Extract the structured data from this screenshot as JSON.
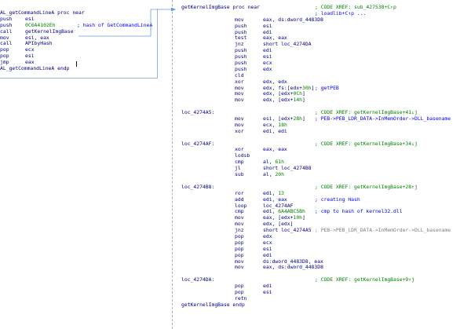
{
  "left_block": [
    {
      "label": "AL_getCommandLineA proc near",
      "mn": "",
      "op": "",
      "cmt": ""
    },
    {
      "label": "",
      "mn": "push",
      "op": "esi",
      "cmt": ""
    },
    {
      "label": "",
      "mn": "push",
      "op": "0C6A4102Eh",
      "cmt": "; hash of GetCommandLineA"
    },
    {
      "label": "",
      "mn": "call",
      "op": "getKernelImgBase",
      "cmt": ""
    },
    {
      "label": "",
      "mn": "mov",
      "op": "esi, eax",
      "cmt": ""
    },
    {
      "label": "",
      "mn": "call",
      "op": "APIbyHash",
      "cmt": ""
    },
    {
      "label": "",
      "mn": "pop",
      "op": "ecx",
      "cmt": ""
    },
    {
      "label": "",
      "mn": "pop",
      "op": "esi",
      "cmt": ""
    },
    {
      "label": "",
      "mn": "jmp",
      "op": "eax",
      "cmt": ""
    },
    {
      "label": "AL_getCommandLineA endp",
      "mn": "",
      "op": "",
      "cmt": ""
    }
  ],
  "right_block": [
    {
      "label": "getKernelImgBase proc near",
      "mn": "",
      "op": "",
      "cmt": "; CODE XREF: sub_427538+C↑p"
    },
    {
      "label": "",
      "mn": "",
      "op": "",
      "cmt": "; loadlib+C↑p ..."
    },
    {
      "label": "",
      "mn": "mov",
      "op": "eax, ds:dword_4483D8",
      "cmt": ""
    },
    {
      "label": "",
      "mn": "push",
      "op": "esi",
      "cmt": ""
    },
    {
      "label": "",
      "mn": "push",
      "op": "edi",
      "cmt": ""
    },
    {
      "label": "",
      "mn": "test",
      "op": "eax, eax",
      "cmt": ""
    },
    {
      "label": "",
      "mn": "jnz",
      "op": "short loc_4274DA",
      "cmt": ""
    },
    {
      "label": "",
      "mn": "push",
      "op": "edi",
      "cmt": ""
    },
    {
      "label": "",
      "mn": "push",
      "op": "esi",
      "cmt": ""
    },
    {
      "label": "",
      "mn": "push",
      "op": "ecx",
      "cmt": ""
    },
    {
      "label": "",
      "mn": "push",
      "op": "edx",
      "cmt": ""
    },
    {
      "label": "",
      "mn": "cld",
      "op": "",
      "cmt": ""
    },
    {
      "label": "",
      "mn": "xor",
      "op": "edx, edx",
      "cmt": ""
    },
    {
      "label": "",
      "mn": "mov",
      "op": "edx, fs:[edx+30h]",
      "cmt": "; getPEB"
    },
    {
      "label": "",
      "mn": "mov",
      "op": "edx, [edx+0Ch]",
      "cmt": ""
    },
    {
      "label": "",
      "mn": "mov",
      "op": "edx, [edx+14h]",
      "cmt": ""
    },
    {
      "label": "",
      "mn": "",
      "op": "",
      "cmt": ""
    },
    {
      "label": "loc_4274A5:",
      "mn": "",
      "op": "",
      "cmt": "; CODE XREF: getKernelImgBase+41↓j"
    },
    {
      "label": "",
      "mn": "mov",
      "op": "esi, [edx+28h]",
      "cmt": "; PEB->PEB_LDR_DATA->InMemOrder->DLL_basename"
    },
    {
      "label": "",
      "mn": "mov",
      "op": "ecx, 18h",
      "cmt": ""
    },
    {
      "label": "",
      "mn": "xor",
      "op": "edi, edi",
      "cmt": ""
    },
    {
      "label": "",
      "mn": "",
      "op": "",
      "cmt": ""
    },
    {
      "label": "loc_4274AF:",
      "mn": "",
      "op": "",
      "cmt": "; CODE XREF: getKernelImgBase+34↓j"
    },
    {
      "label": "",
      "mn": "xor",
      "op": "eax, eax",
      "cmt": ""
    },
    {
      "label": "",
      "mn": "lodsb",
      "op": "",
      "cmt": ""
    },
    {
      "label": "",
      "mn": "cmp",
      "op": "al, 61h",
      "cmt": ""
    },
    {
      "label": "",
      "mn": "jl",
      "op": "short loc_4274B8",
      "cmt": ""
    },
    {
      "label": "",
      "mn": "sub",
      "op": "al, 20h",
      "cmt": ""
    },
    {
      "label": "",
      "mn": "",
      "op": "",
      "cmt": ""
    },
    {
      "label": "loc_4274B8:",
      "mn": "",
      "op": "",
      "cmt": "; CODE XREF: getKernelImgBase+28↑j"
    },
    {
      "label": "",
      "mn": "ror",
      "op": "edi, 13",
      "cmt": ""
    },
    {
      "label": "",
      "mn": "add",
      "op": "edi, eax",
      "cmt": "; creating Hash"
    },
    {
      "label": "",
      "mn": "loop",
      "op": "loc_4274AF",
      "cmt": ""
    },
    {
      "label": "",
      "mn": "cmp",
      "op": "edi, 6A4ABC5Bh",
      "cmt": "; cmp to hash of kernel32.dll"
    },
    {
      "label": "",
      "mn": "mov",
      "op": "eax, [edx+10h]",
      "cmt": ""
    },
    {
      "label": "",
      "mn": "mov",
      "op": "edx, [edx]",
      "cmt": ""
    },
    {
      "label": "",
      "mn": "jnz",
      "op": "short loc_4274A5",
      "cmt": "; PEB->PEB_LDR_DATA->InMemOrder->DLL_basename"
    },
    {
      "label": "",
      "mn": "pop",
      "op": "edx",
      "cmt": ""
    },
    {
      "label": "",
      "mn": "pop",
      "op": "ecx",
      "cmt": ""
    },
    {
      "label": "",
      "mn": "pop",
      "op": "esi",
      "cmt": ""
    },
    {
      "label": "",
      "mn": "pop",
      "op": "edi",
      "cmt": ""
    },
    {
      "label": "",
      "mn": "mov",
      "op": "ds:dword_4483D8, eax",
      "cmt": ""
    },
    {
      "label": "",
      "mn": "mov",
      "op": "eax, ds:dword_4483D8",
      "cmt": ""
    },
    {
      "label": "",
      "mn": "",
      "op": "",
      "cmt": ""
    },
    {
      "label": "loc_4274DA:",
      "mn": "",
      "op": "",
      "cmt": "; CODE XREF: getKernelImgBase+9↑j"
    },
    {
      "label": "",
      "mn": "pop",
      "op": "edi",
      "cmt": ""
    },
    {
      "label": "",
      "mn": "pop",
      "op": "esi",
      "cmt": ""
    },
    {
      "label": "",
      "mn": "retn",
      "op": "",
      "cmt": ""
    },
    {
      "label": "getKernelImgBase endp",
      "mn": "",
      "op": "",
      "cmt": ""
    }
  ],
  "colors": {
    "label": "#000080",
    "mnemonic": "#000080",
    "operand": "#000080",
    "number": "#008000",
    "comment": "#0000ff",
    "xref": "#008000",
    "connector": "#6a9ad8"
  }
}
